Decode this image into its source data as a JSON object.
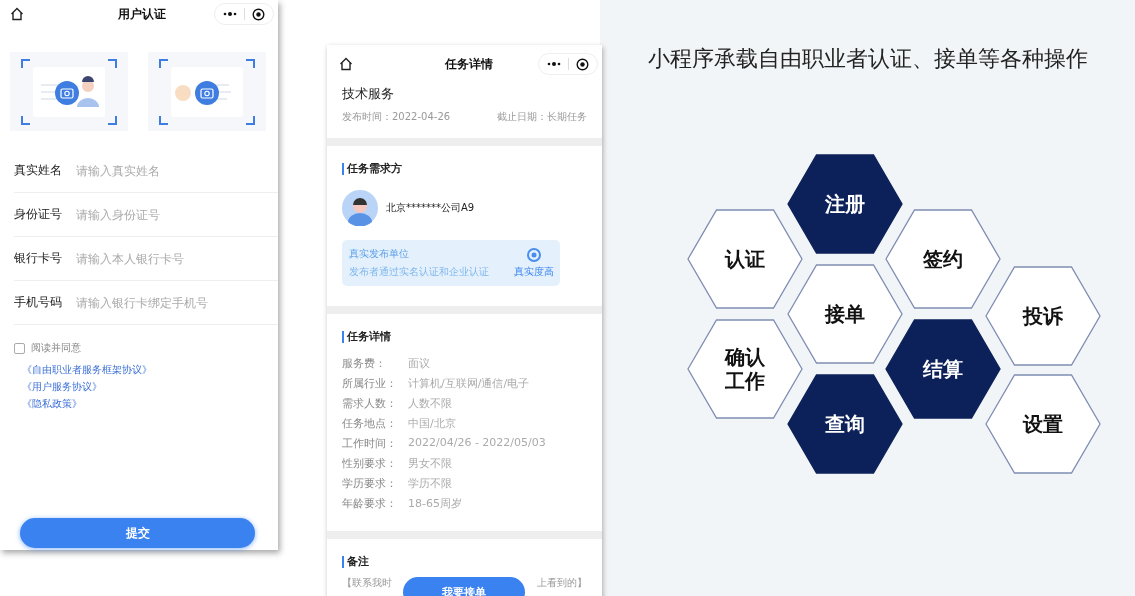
{
  "auth_screen": {
    "title": "用户认证",
    "fields": [
      {
        "label": "真实姓名",
        "placeholder": "请输入真实姓名"
      },
      {
        "label": "身份证号",
        "placeholder": "请输入身份证号"
      },
      {
        "label": "银行卡号",
        "placeholder": "请输入本人银行卡号"
      },
      {
        "label": "手机号码",
        "placeholder": "请输入银行卡绑定手机号"
      }
    ],
    "agree": {
      "label": "阅读并同意",
      "checked": false
    },
    "links": [
      "《自由职业者服务框架协议》",
      "《用户服务协议》",
      "《隐私政策》"
    ],
    "submit": "提交"
  },
  "task_screen": {
    "title": "任务详情",
    "task_name": "技术服务",
    "publish_time": "发布时间：2022-04-26",
    "deadline": "截止日期：长期任务",
    "requester_heading": "任务需求方",
    "requester": "北京*******公司A9",
    "verified": {
      "title": "真实发布单位",
      "note": "发布者通过实名认证和企业认证",
      "badge": "真实度高"
    },
    "details_heading": "任务详情",
    "details": [
      {
        "label": "服务费：",
        "value": "面议"
      },
      {
        "label": "所属行业：",
        "value": "计算机/互联网/通信/电子"
      },
      {
        "label": "需求人数：",
        "value": "人数不限"
      },
      {
        "label": "任务地点：",
        "value": "中国/北京"
      },
      {
        "label": "工作时间：",
        "value": "2022/04/26 - 2022/05/03"
      },
      {
        "label": "性别要求：",
        "value": "男女不限"
      },
      {
        "label": "学历要求：",
        "value": "学历不限"
      },
      {
        "label": "年龄要求：",
        "value": "18-65周岁"
      }
    ],
    "remark_heading": "备注",
    "remark_fragments": [
      "【联系我时",
      "上看到的】"
    ],
    "accept_button": "我要接单"
  },
  "slide": {
    "title": "小程序承载自由职业者认证、接单等各种操作",
    "hexagons": [
      {
        "lines": [
          "注册"
        ],
        "filled": true
      },
      {
        "lines": [
          "认证"
        ],
        "filled": false
      },
      {
        "lines": [
          "签约"
        ],
        "filled": false
      },
      {
        "lines": [
          "接单"
        ],
        "filled": false
      },
      {
        "lines": [
          "投诉"
        ],
        "filled": false
      },
      {
        "lines": [
          "确认",
          "工作"
        ],
        "filled": false
      },
      {
        "lines": [
          "结算"
        ],
        "filled": true
      },
      {
        "lines": [
          "查询"
        ],
        "filled": true
      },
      {
        "lines": [
          "设置"
        ],
        "filled": false
      }
    ]
  }
}
